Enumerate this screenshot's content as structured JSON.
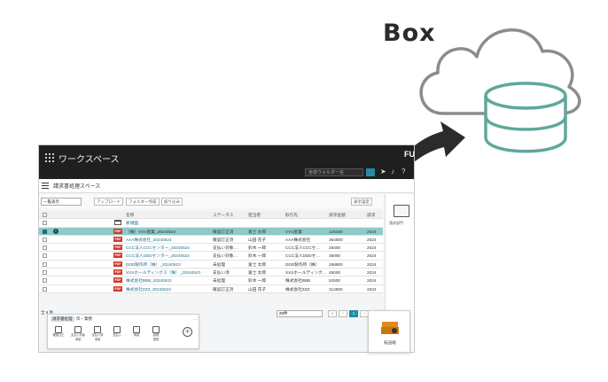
{
  "illustration": {
    "service_label": "Box",
    "colors": {
      "cloud_stroke": "#8c8c8c",
      "database_stroke": "#5ea89a",
      "arrow": "#2b2b2b"
    }
  },
  "app": {
    "title": "ワークスペース",
    "brand": "FU",
    "search_placeholder": "全体ウォルダー名",
    "workspace_title": "請求書処理スペース",
    "toolbar": {
      "view_select": "一覧表示",
      "upload": "アップロード",
      "folder_create": "フォルダー作成",
      "filter": "絞り込み",
      "display_settings": "表示設定"
    },
    "table": {
      "headers": [
        "名称",
        "ステータス",
        "担当者",
        "取引先",
        "請求金額",
        "請求"
      ],
      "rows": [
        {
          "type": "folder",
          "name": "新規図",
          "status": "",
          "assignee": "",
          "partner": "",
          "amount": "",
          "date": "",
          "selected": false
        },
        {
          "type": "pdf",
          "name": "（株）VVV産業_20240524",
          "status": "確認訂正済",
          "assignee": "富士 太郎",
          "partner": "VVV産業",
          "amount": "125480",
          "date": "2024",
          "selected": true
        },
        {
          "type": "pdf",
          "name": "AAA株式会社_20240524",
          "status": "確認訂正済",
          "assignee": "山田 花子",
          "partner": "AAA株式会社",
          "amount": "364500",
          "date": "2024",
          "selected": false
        },
        {
          "type": "pdf",
          "name": "CCC法人CCCセンター_20240524",
          "status": "支払い対象…",
          "assignee": "鈴木 一郎",
          "partner": "CCC法人CCCセ…",
          "amount": "28400",
          "date": "2024",
          "selected": false
        },
        {
          "type": "pdf",
          "name": "CCC法人DDDセンター_20240524",
          "status": "支払い対象…",
          "assignee": "鈴木 一郎",
          "partner": "CCC法人DDDセ…",
          "amount": "35000",
          "date": "2024",
          "selected": false
        },
        {
          "type": "pdf",
          "name": "DDD製作所（株）_20240523",
          "status": "未処理",
          "assignee": "富士 太郎",
          "partner": "DDD製作所（株）",
          "amount": "298900",
          "date": "2024",
          "selected": false
        },
        {
          "type": "pdf",
          "name": "XXXホールディングス（株）_20240523",
          "status": "支払い済",
          "assignee": "富士 太郎",
          "partner": "XXXホールディング…",
          "amount": "45000",
          "date": "2024",
          "selected": false
        },
        {
          "type": "pdf",
          "name": "株式会社BBB_20240522",
          "status": "未処理",
          "assignee": "鈴木 一郎",
          "partner": "株式会社BBB",
          "amount": "52500",
          "date": "2024",
          "selected": false
        },
        {
          "type": "pdf",
          "name": "株式会社ZZZ_20240523",
          "status": "確認訂正済",
          "assignee": "山田 花子",
          "partner": "株式会社ZZZ",
          "amount": "314800",
          "date": "2024",
          "selected": false
        }
      ]
    },
    "right_pane": {
      "label": "請求部門"
    },
    "bottom": {
      "total": "全 9 件",
      "per_page": "20件",
      "current_page": "1",
      "panel_tabs": [
        "請求書処理",
        "伝・業務"
      ],
      "actions": [
        "確認訂正",
        "支払い対象",
        "支払い済",
        "支払い",
        "承認",
        "経理"
      ],
      "action_sublabels": [
        "",
        "承認",
        "承認",
        "",
        "",
        "登録"
      ]
    },
    "inbox_label": "転送箱"
  }
}
